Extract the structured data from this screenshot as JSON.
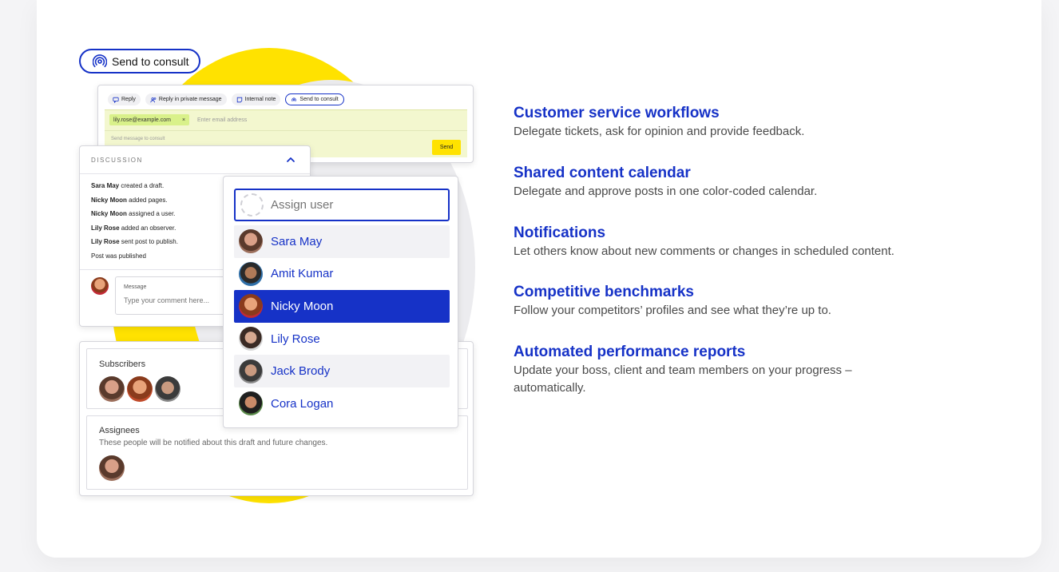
{
  "consult_pill": {
    "label": "Send to consult",
    "icon": "broadcast-icon"
  },
  "reply_panel": {
    "tabs": [
      {
        "label": "Reply",
        "icon": "chat-icon"
      },
      {
        "label": "Reply in private message",
        "icon": "users-icon"
      },
      {
        "label": "Internal note",
        "icon": "note-icon"
      },
      {
        "label": "Send to consult",
        "icon": "broadcast-icon"
      }
    ],
    "email_chip": "lily.rose@example.com",
    "email_chip_remove": "×",
    "email_placeholder": "Enter email address",
    "message_placeholder": "Send message to consult",
    "send_label": "Send"
  },
  "discussion": {
    "title": "DISCUSSION",
    "items": [
      {
        "name": "Sara May",
        "action": " created a draft."
      },
      {
        "name": "Nicky Moon",
        "action": " added pages."
      },
      {
        "name": "Nicky Moon",
        "action": " assigned a user."
      },
      {
        "name": "Lily Rose",
        "action": " added an observer."
      },
      {
        "name": "Lily Rose",
        "action": " sent post to publish."
      },
      {
        "name": "",
        "action": "Post was published"
      }
    ],
    "message_label": "Message",
    "message_placeholder": "Type your comment here..."
  },
  "subscribers": {
    "label": "Subscribers"
  },
  "assignees": {
    "label": "Assignees",
    "note": "These people will be notified about this draft and future changes."
  },
  "assign_dropdown": {
    "placeholder": "Assign user",
    "users": [
      {
        "name": "Sara May",
        "state": "hover"
      },
      {
        "name": "Amit Kumar",
        "state": "normal"
      },
      {
        "name": "Nicky Moon",
        "state": "selected"
      },
      {
        "name": "Lily Rose",
        "state": "normal"
      },
      {
        "name": "Jack Brody",
        "state": "hover"
      },
      {
        "name": "Cora Logan",
        "state": "normal"
      }
    ]
  },
  "features": [
    {
      "title": "Customer service workflows",
      "desc": "Delegate tickets, ask for opinion and provide feedback."
    },
    {
      "title": "Shared content calendar",
      "desc": "Delegate and approve posts in one color-coded calendar."
    },
    {
      "title": "Notifications",
      "desc": "Let others know about new comments or changes in scheduled content."
    },
    {
      "title": "Competitive benchmarks",
      "desc": "Follow your competitors’ profiles and see what they’re up to."
    },
    {
      "title": "Automated performance reports",
      "desc": "Update your boss, client and team members on your progress – automatically."
    }
  ],
  "colors": {
    "accent": "#1632c7",
    "highlight": "#ffe200",
    "reply_bg": "#f3f7cf"
  }
}
